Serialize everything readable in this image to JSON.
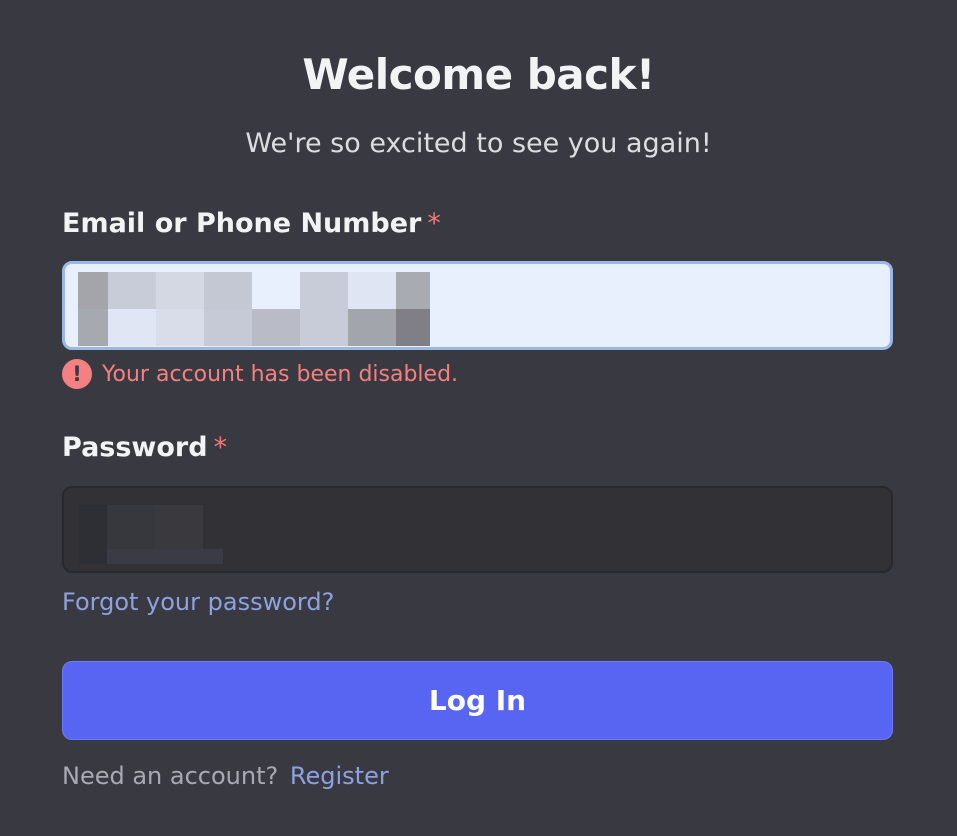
{
  "header": {
    "title": "Welcome back!",
    "subtitle": "We're so excited to see you again!"
  },
  "email": {
    "label": "Email or Phone Number",
    "required_mark": "*",
    "error_icon": "!",
    "error": "Your account has been disabled."
  },
  "password": {
    "label": "Password",
    "required_mark": "*"
  },
  "links": {
    "forgot": "Forgot your password?",
    "need_account": "Need an account?",
    "register": "Register"
  },
  "login_button": {
    "label": "Log In"
  },
  "colors": {
    "background": "#393a41",
    "accent": "#5865f2",
    "link": "#8ea1e1",
    "error": "#f48081",
    "email_bg": "#e8effd",
    "password_bg": "#313136"
  },
  "icons": {
    "error": "exclamation-circle-icon"
  }
}
